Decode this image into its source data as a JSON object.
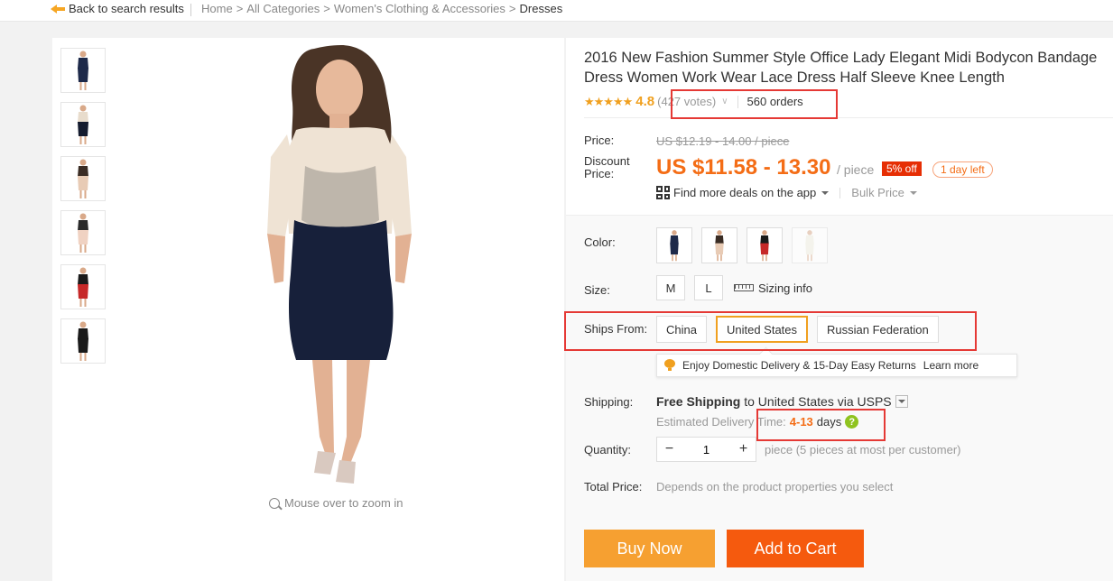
{
  "topbar": {
    "back_label": "Back to search results",
    "breadcrumb": [
      "Home",
      "All Categories",
      "Women's Clothing & Accessories",
      "Dresses"
    ],
    "separator": ">"
  },
  "gallery": {
    "thumbnails": [
      {
        "colors": {
          "top": "#1e2a4a",
          "bottom": "#1e2a4a"
        }
      },
      {
        "colors": {
          "top": "#e8dccc",
          "bottom": "#141b2e"
        }
      },
      {
        "colors": {
          "top": "#3a2c24",
          "bottom": "#e8cbb5"
        }
      },
      {
        "colors": {
          "top": "#2a2a2a",
          "bottom": "#f0d2c2"
        }
      },
      {
        "colors": {
          "top": "#1a1a1a",
          "bottom": "#c62828"
        }
      },
      {
        "colors": {
          "top": "#1a1a1a",
          "bottom": "#1a1a1a"
        }
      }
    ],
    "zoom_hint": "Mouse over to zoom in"
  },
  "product": {
    "title": "2016 New Fashion Summer Style Office Lady Elegant Midi Bodycon Bandage Dress Women Work Wear Lace Dress Half Sleeve Knee Length",
    "stars": "★★★★★",
    "rating": "4.8",
    "votes": "(427 votes)",
    "orders": "560 orders",
    "price_label": "Price:",
    "original_price": "US $12.19 - 14.00 / piece",
    "discount_label": "Discount Price:",
    "discount_price": "US $11.58 - 13.30",
    "per_piece": "/ piece",
    "off_badge": "5% off",
    "days_left": "1 day left",
    "deals_label": "Find more deals on the app",
    "bulk_label": "Bulk Price"
  },
  "options": {
    "color_label": "Color:",
    "colors": [
      {
        "top": "#1e2a4a",
        "bottom": "#1e2a4a"
      },
      {
        "top": "#3a2c24",
        "bottom": "#e8cbb5"
      },
      {
        "top": "#1a1a1a",
        "bottom": "#c62828"
      },
      {
        "top": "#f0efe0",
        "bottom": "#f0efe0"
      }
    ],
    "size_label": "Size:",
    "sizes": [
      "M",
      "L"
    ],
    "sizing_info": "Sizing info",
    "ships_from_label": "Ships From:",
    "ships_from": [
      "China",
      "United States",
      "Russian Federation"
    ],
    "ships_from_selected": "United States",
    "tooltip_text": "Enjoy Domestic Delivery & 15-Day Easy Returns",
    "tooltip_link": "Learn more",
    "shipping_label": "Shipping:",
    "shipping_free": "Free Shipping",
    "shipping_rest": " to United States via USPS",
    "est_label": "Estimated Delivery Time:",
    "est_days": "4-13",
    "est_unit": "days",
    "quantity_label": "Quantity:",
    "quantity_value": "1",
    "quantity_note": "piece (5 pieces at most per customer)",
    "total_label": "Total Price:",
    "total_value": "Depends on the product properties you select"
  },
  "actions": {
    "buy_now": "Buy Now",
    "add_to_cart": "Add to Cart"
  },
  "colors": {
    "accent_orange": "#f46d16",
    "buy_now_bg": "#f6a031",
    "add_cart_bg": "#f55a0e",
    "highlight_red": "#e53935"
  }
}
